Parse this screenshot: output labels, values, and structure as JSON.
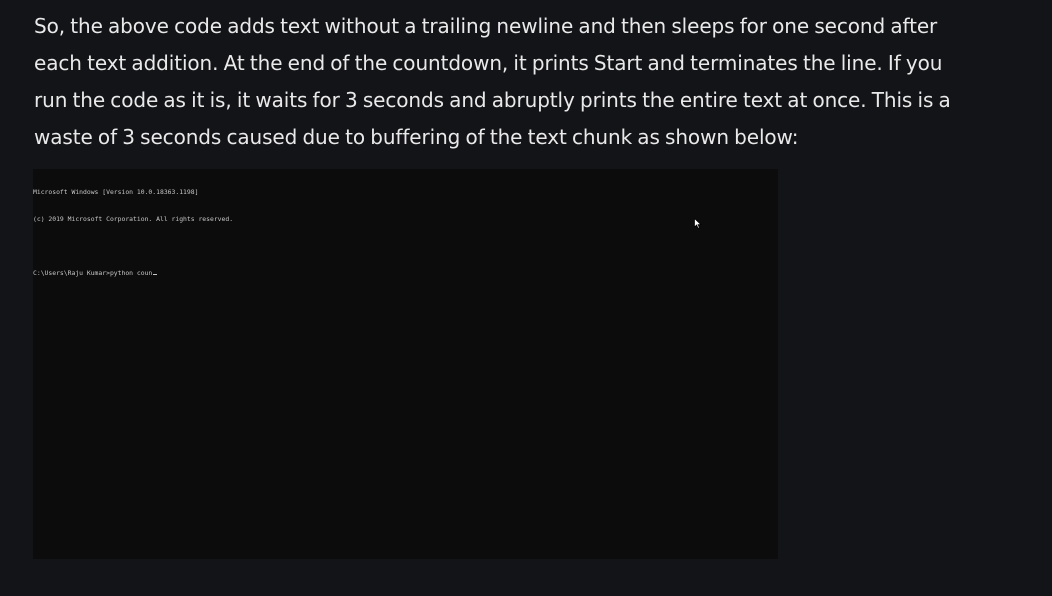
{
  "article": {
    "paragraph_lines": [
      "So, the above code adds text without a trailing newline and then sleeps for one second after",
      "each text addition. At the end of the countdown, it prints Start and terminates the line. If you",
      "run the code as it is, it waits for 3 seconds and abruptly prints the entire text at once. This is a",
      "waste of 3 seconds caused due to buffering of the text chunk as shown below:"
    ]
  },
  "terminal": {
    "lines": [
      "Microsoft Windows [Version 10.0.18363.1198]",
      "(c) 2019 Microsoft Corporation. All rights reserved.",
      "",
      "C:\\Users\\Raju Kumar>python coun"
    ],
    "icons": {
      "mouse_pointer": "mouse-pointer-icon",
      "text_cursor": "text-cursor-icon"
    }
  },
  "colors": {
    "page_background": "#131417",
    "body_text": "#e9e9ea",
    "terminal_background": "#0c0c0c",
    "terminal_text": "#c7c7c7"
  }
}
